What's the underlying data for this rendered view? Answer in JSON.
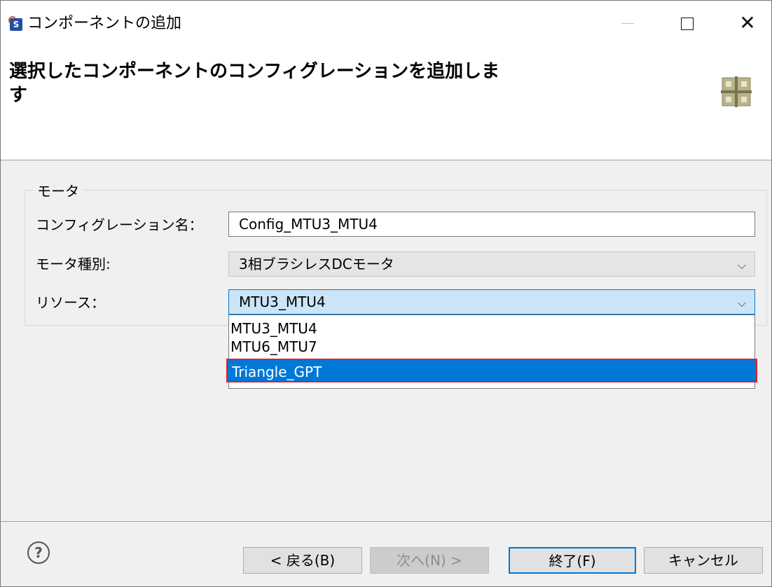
{
  "window": {
    "title": "コンポーネントの追加",
    "app_icon_letter": "S",
    "close_glyph": "✕"
  },
  "header": {
    "heading": "選択したコンポーネントのコンフィグレーションを追加します"
  },
  "group": {
    "title": "モータ",
    "config_name_label": "コンフィグレーション名：",
    "config_name_value": "Config_MTU3_MTU4",
    "motor_type_label": "モータ種別:",
    "motor_type_value": "3相ブラシレスDCモータ",
    "resource_label": "リソース：",
    "resource_value": "MTU3_MTU4",
    "chevron_glyph": "⌵",
    "resource_options": [
      "MTU3_MTU4",
      "MTU6_MTU7",
      "Triangle_GPT"
    ],
    "highlighted_option": "Triangle_GPT"
  },
  "footer": {
    "help_glyph": "?",
    "back_label": "< 戻る(B)",
    "next_label": "次へ(N) >",
    "finish_label": "終了(F)",
    "cancel_label": "キャンセル"
  },
  "icons": {
    "app": "renesas-smart-configurator-icon",
    "wizard": "component-grid-icon",
    "help": "help-circle-icon",
    "dropdown": "chevron-down-icon"
  },
  "colors": {
    "selection": "#0078d7",
    "highlight_border": "#e0202a",
    "content_bg": "#f0f0f0"
  }
}
